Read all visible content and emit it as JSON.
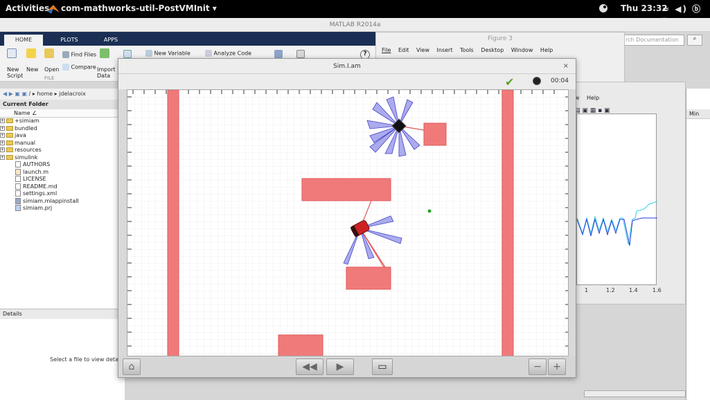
{
  "os_bar": {
    "activities": "Activities",
    "app_name": "com-mathworks-util-PostVMInit ▾",
    "clock": "Thu 23:32",
    "system_icons": "≈ ◀) ⓑ ▾"
  },
  "matlab": {
    "window_title": "MATLAB R2014a",
    "tabs": [
      "HOME",
      "PLOTS",
      "APPS"
    ],
    "ribbon": {
      "new_script": "New\nScript",
      "new": "New",
      "open": "Open",
      "find_files": "Find Files",
      "compare": "Compare",
      "import_data": "Import\nData",
      "new_variable": "New Variable",
      "analyze_code": "Analyze Code",
      "file_section": "FILE"
    },
    "search_placeholder": "rch Documentation",
    "address": "/ ▸ home ▸ jdelacroix",
    "current_folder_title": "Current Folder",
    "name_column": "Name ∠",
    "files": [
      {
        "name": "+simiam",
        "type": "folder"
      },
      {
        "name": "bundled",
        "type": "folder"
      },
      {
        "name": "java",
        "type": "folder"
      },
      {
        "name": "manual",
        "type": "folder"
      },
      {
        "name": "resources",
        "type": "folder"
      },
      {
        "name": "simulink",
        "type": "folder"
      },
      {
        "name": "AUTHORS",
        "type": "file"
      },
      {
        "name": "launch.m",
        "type": "file"
      },
      {
        "name": "LICENSE",
        "type": "file"
      },
      {
        "name": "README.md",
        "type": "file"
      },
      {
        "name": "settings.xml",
        "type": "file"
      },
      {
        "name": "simiam.mlappinstall",
        "type": "file"
      },
      {
        "name": "simiam.prj",
        "type": "file"
      }
    ],
    "details_title": "Details",
    "details_message": "Select a file to view details",
    "right_panel_header": "Min"
  },
  "figure3": {
    "title": "Figure 3",
    "menu": [
      "File",
      "Edit",
      "View",
      "Insert",
      "Tools",
      "Desktop",
      "Window",
      "Help"
    ]
  },
  "figure_back": {
    "menu_view": "ow",
    "menu_help": "Help",
    "x_ticks": [
      "1",
      "1.2",
      "1.4",
      "1.6"
    ]
  },
  "sim": {
    "title": "Sim.I.am",
    "close": "×",
    "timer": "00:04",
    "controls": {
      "home": "⌂",
      "rewind": "◀◀",
      "play": "▶",
      "screen": "▭",
      "zoom_out": "−",
      "zoom_in": "+"
    }
  },
  "colors": {
    "obstacle": "#f08080",
    "sensor_cone": "#5a5ad6",
    "robot": "#cc2222",
    "goal": "#2ca02c"
  }
}
